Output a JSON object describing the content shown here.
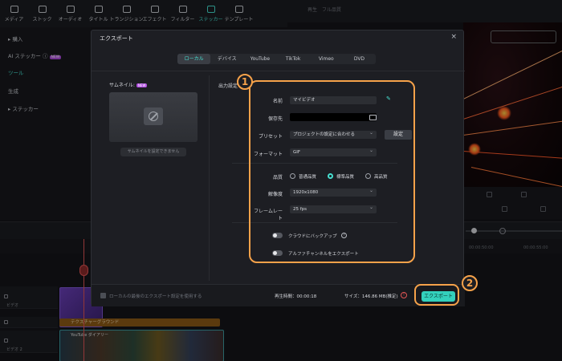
{
  "toolbar": {
    "items": [
      {
        "label": "メディア",
        "icon": "media-icon"
      },
      {
        "label": "ストック",
        "icon": "stock-icon"
      },
      {
        "label": "オーディオ",
        "icon": "audio-icon"
      },
      {
        "label": "タイトル",
        "icon": "title-icon"
      },
      {
        "label": "トランジション",
        "icon": "transition-icon"
      },
      {
        "label": "エフェクト",
        "icon": "effect-icon"
      },
      {
        "label": "フィルター",
        "icon": "filter-icon"
      },
      {
        "label": "ステッカー",
        "icon": "sticker-icon",
        "active": true
      },
      {
        "label": "テンプレート",
        "icon": "template-icon"
      }
    ]
  },
  "left_panel": {
    "items": [
      {
        "label": "▸ 購入"
      },
      {
        "label": "AI ステッカー ⓘ",
        "badge": "NEW"
      },
      {
        "label": "ツール",
        "active": true
      },
      {
        "label": "生成"
      },
      {
        "label": "▸ ステッカー"
      }
    ]
  },
  "preview": {
    "player_label": "再生　フル品質"
  },
  "timeline": {
    "ruler_marks": [
      "00:00:50:00",
      "00:00:55:00"
    ],
    "tracks": [
      {
        "label": "ビデオ"
      },
      {
        "label": ""
      },
      {
        "label": "ビデオ 2"
      }
    ],
    "texture_clip_label": "テクスチャーグラウンド",
    "video_clip_label": "YouTube ダイアリー"
  },
  "dialog": {
    "title": "エクスポート",
    "close_label": "×",
    "tabs": [
      "ローカル",
      "デバイス",
      "YouTube",
      "TikTok",
      "Vimeo",
      "DVD"
    ],
    "active_tab": "ローカル",
    "thumbnail": {
      "label": "サムネイル",
      "badge": "NEW",
      "button_label": "サムネイルを設定できません"
    },
    "output_label": "出力設定",
    "form": {
      "name_label": "名前",
      "name_value": "マイビデオ",
      "save_label": "保存先",
      "save_value": "",
      "preset_label": "プリセット",
      "preset_value": "プロジェクトの設定に合わせる",
      "preset_button": "設定",
      "format_label": "フォーマット",
      "format_value": "GIF",
      "quality_label": "品質",
      "quality_options": [
        "普通品質",
        "標準品質",
        "高品質"
      ],
      "quality_selected": "標準品質",
      "resolution_label": "解像度",
      "resolution_value": "1920x1080",
      "framerate_label": "フレームレート",
      "framerate_value": "25 fps",
      "cloud_backup_label": "クラウドにバックアップ",
      "alpha_label": "アルファチャンネルをエクスポート"
    },
    "footer": {
      "checkbox_label": "ローカルの最後のエクスポート設定を使用する",
      "duration": "再生時間：00:00:18",
      "size": "サイズ：146.86 MB(推定)",
      "export_button": "エクスポート"
    }
  },
  "annotations": {
    "marker_1": "1",
    "marker_2": "2",
    "color": "#f6a24a"
  },
  "colors": {
    "accent": "#46e0d1",
    "export_button": "#33d1bd",
    "badge": "#b14fe0"
  }
}
